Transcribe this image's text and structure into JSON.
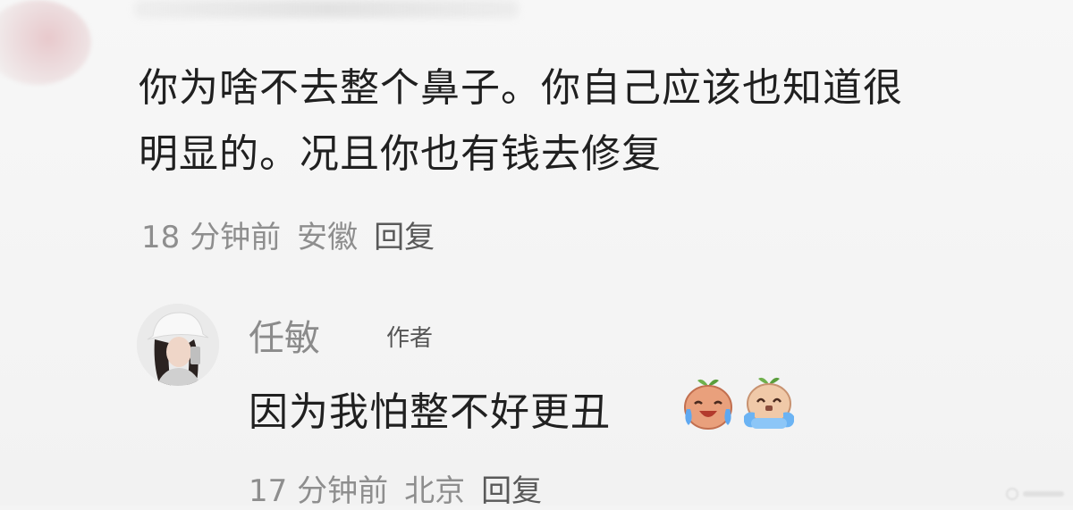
{
  "comment": {
    "lines": [
      "你为啥不去整个鼻子。你自己应该也知道很",
      "明显的。况且你也有钱去修复"
    ],
    "time": "18 分钟前",
    "location": "安徽",
    "reply_label": "回复"
  },
  "reply": {
    "author_name": "任敏",
    "author_badge": "作者",
    "text": "因为我怕整不好更丑",
    "emojis": [
      "laughing-crying-emoji",
      "crying-emoji"
    ],
    "time": "17 分钟前",
    "location": "北京",
    "reply_label": "回复"
  }
}
